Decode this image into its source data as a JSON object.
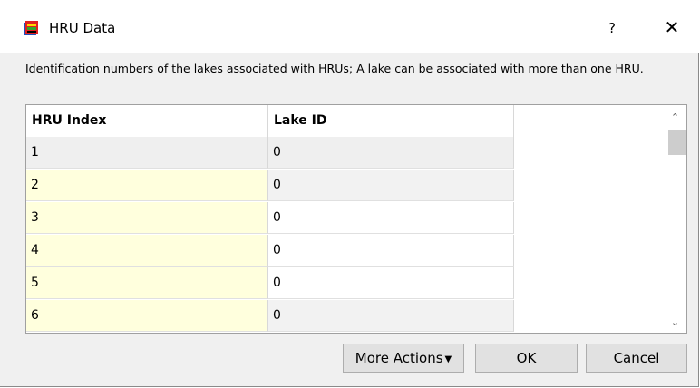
{
  "window": {
    "title": "HRU Data",
    "help_label": "?",
    "close_label": "✕"
  },
  "description": "Identification numbers of the lakes associated with HRUs; A lake can be associated with more than one HRU.",
  "table": {
    "columns": [
      "HRU Index",
      "Lake ID"
    ],
    "rows": [
      [
        "1",
        "0"
      ],
      [
        "2",
        "0"
      ],
      [
        "3",
        "0"
      ],
      [
        "4",
        "0"
      ],
      [
        "5",
        "0"
      ],
      [
        "6",
        "0"
      ]
    ]
  },
  "scrollbar": {
    "up_glyph": "⌃",
    "down_glyph": "⌄"
  },
  "buttons": {
    "more_actions": "More Actions",
    "more_caret": "▼",
    "ok": "OK",
    "cancel": "Cancel"
  },
  "colors": {
    "editable_cell": "#ffffdd",
    "selected_row": "#efefef",
    "button_face": "#e1e1e1"
  }
}
